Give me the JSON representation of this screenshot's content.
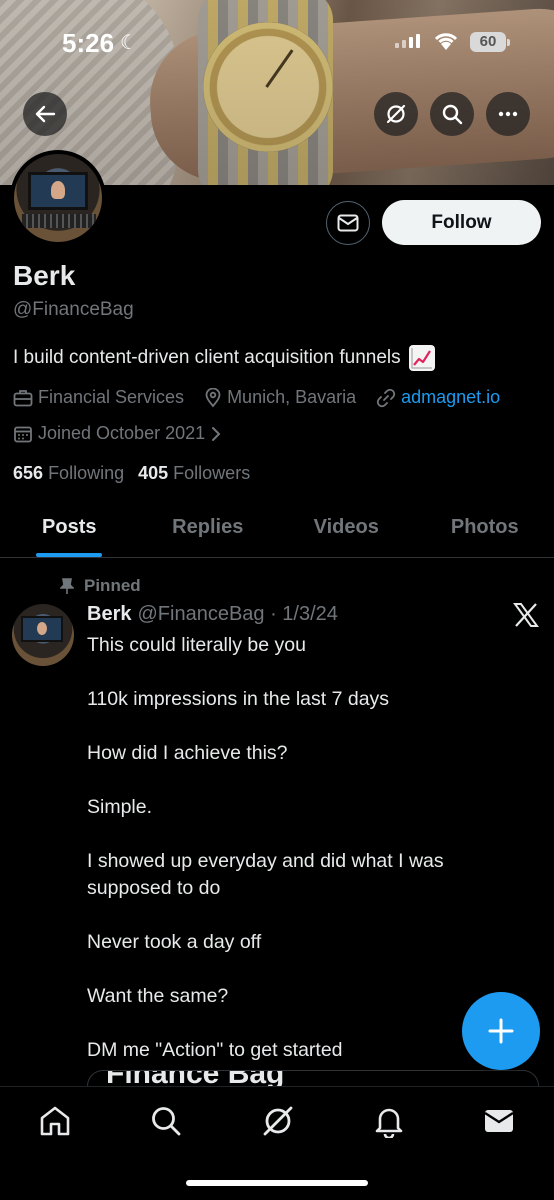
{
  "status_bar": {
    "time": "5:26",
    "battery": "60"
  },
  "profile": {
    "name": "Berk",
    "handle": "@FinanceBag",
    "bio": "I build content-driven client acquisition funnels",
    "category": "Financial Services",
    "location": "Munich, Bavaria",
    "website": "admagnet.io",
    "joined": "Joined October 2021",
    "following_count": "656",
    "following_label": "Following",
    "followers_count": "405",
    "followers_label": "Followers"
  },
  "actions": {
    "follow_label": "Follow"
  },
  "tabs": [
    {
      "label": "Posts",
      "active": true
    },
    {
      "label": "Replies",
      "active": false
    },
    {
      "label": "Videos",
      "active": false
    },
    {
      "label": "Photos",
      "active": false
    }
  ],
  "post": {
    "pinned_label": "Pinned",
    "author": "Berk",
    "handle_date": "@FinanceBag · 1/3/24",
    "lines": [
      "This could literally be you",
      "110k impressions in the last 7 days",
      "How did I achieve this?",
      "Simple.",
      "I showed up everyday and did what I was supposed to do",
      "Never took a day off",
      "Want the same?",
      "DM me \"Action\" to get started"
    ],
    "card_peek_text": "Finance Bag"
  },
  "colors": {
    "accent": "#1d9bf0",
    "background": "#000000",
    "muted": "#71767b",
    "text": "#e7e9ea"
  },
  "icons": {
    "back": "arrow-left-icon",
    "grok": "grok-icon",
    "search": "search-icon",
    "more": "more-icon",
    "message": "envelope-icon",
    "compose": "plus-icon",
    "nav": [
      "home-icon",
      "search-icon",
      "grok-icon",
      "bell-icon",
      "mail-icon"
    ]
  }
}
